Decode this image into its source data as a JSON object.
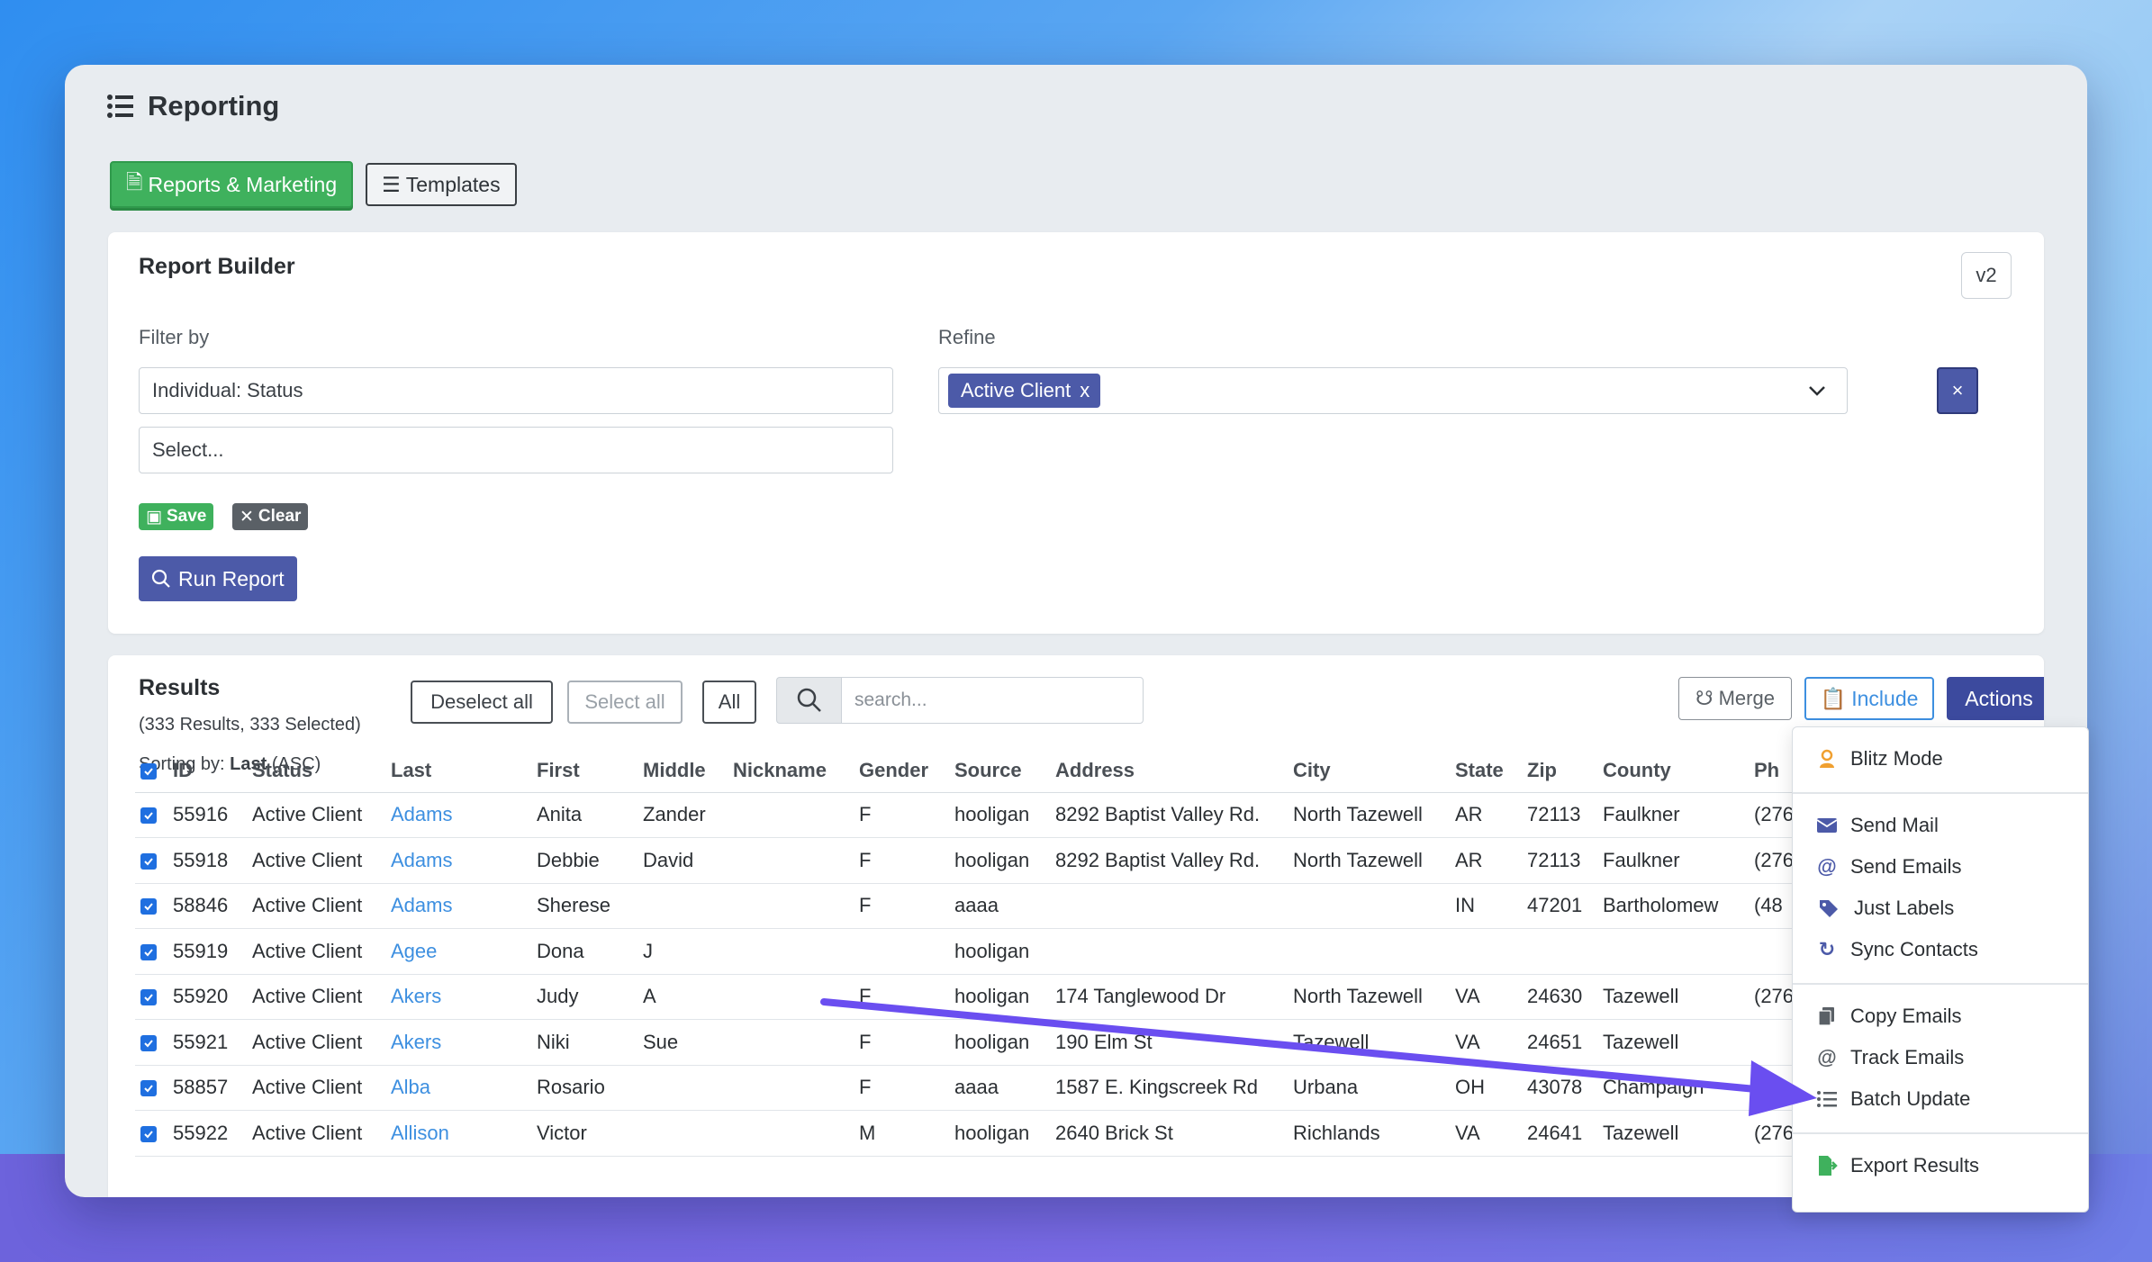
{
  "page": {
    "title": "Reporting"
  },
  "tabs": [
    {
      "label": "Reports & Marketing"
    },
    {
      "label": "Templates"
    }
  ],
  "builder": {
    "title": "Report Builder",
    "version": "v2",
    "filter_label": "Filter by",
    "filter_value": "Individual: Status",
    "filter_placeholder": "Select...",
    "refine_label": "Refine",
    "refine_chip": "Active Client",
    "refine_chip_remove": "x",
    "clear_refine": "×",
    "save_label": "Save",
    "clear_label": "Clear",
    "run_label": "Run Report"
  },
  "results": {
    "title": "Results",
    "summary": "(333 Results, 333 Selected)",
    "sorting_prefix": "Sorting by:",
    "sorting_field": "Last",
    "sorting_dir": "(ASC)",
    "deselect_all": "Deselect all",
    "select_all": "Select all",
    "all": "All",
    "search_placeholder": "search...",
    "merge": "Merge",
    "include": "Include",
    "actions": "Actions",
    "columns": [
      "ID",
      "Status",
      "Last",
      "First",
      "Middle",
      "Nickname",
      "Gender",
      "Source",
      "Address",
      "City",
      "State",
      "Zip",
      "County",
      "Ph"
    ],
    "rows": [
      {
        "id": "55916",
        "status": "Active Client",
        "last": "Adams",
        "first": "Anita",
        "middle": "Zander",
        "nickname": "",
        "gender": "F",
        "source": "hooligan",
        "address": "8292 Baptist Valley Rd.",
        "city": "North Tazewell",
        "state": "AR",
        "zip": "72113",
        "county": "Faulkner",
        "phone": "(276"
      },
      {
        "id": "55918",
        "status": "Active Client",
        "last": "Adams",
        "first": "Debbie",
        "middle": "David",
        "nickname": "",
        "gender": "F",
        "source": "hooligan",
        "address": "8292 Baptist Valley Rd.",
        "city": "North Tazewell",
        "state": "AR",
        "zip": "72113",
        "county": "Faulkner",
        "phone": "(276"
      },
      {
        "id": "58846",
        "status": "Active Client",
        "last": "Adams",
        "first": "Sherese",
        "middle": "",
        "nickname": "",
        "gender": "F",
        "source": "aaaa",
        "address": "",
        "city": "",
        "state": "IN",
        "zip": "47201",
        "county": "Bartholomew",
        "phone": "(48"
      },
      {
        "id": "55919",
        "status": "Active Client",
        "last": "Agee",
        "first": "Dona",
        "middle": "J",
        "nickname": "",
        "gender": "",
        "source": "hooligan",
        "address": "",
        "city": "",
        "state": "",
        "zip": "",
        "county": "",
        "phone": ""
      },
      {
        "id": "55920",
        "status": "Active Client",
        "last": "Akers",
        "first": "Judy",
        "middle": "A",
        "nickname": "",
        "gender": "F",
        "source": "hooligan",
        "address": "174 Tanglewood Dr",
        "city": "North Tazewell",
        "state": "VA",
        "zip": "24630",
        "county": "Tazewell",
        "phone": "(276"
      },
      {
        "id": "55921",
        "status": "Active Client",
        "last": "Akers",
        "first": "Niki",
        "middle": "Sue",
        "nickname": "",
        "gender": "F",
        "source": "hooligan",
        "address": "190 Elm St",
        "city": "Tazewell",
        "state": "VA",
        "zip": "24651",
        "county": "Tazewell",
        "phone": ""
      },
      {
        "id": "58857",
        "status": "Active Client",
        "last": "Alba",
        "first": "Rosario",
        "middle": "",
        "nickname": "",
        "gender": "F",
        "source": "aaaa",
        "address": "1587 E. Kingscreek Rd",
        "city": "Urbana",
        "state": "OH",
        "zip": "43078",
        "county": "Champaign",
        "phone": "(48"
      },
      {
        "id": "55922",
        "status": "Active Client",
        "last": "Allison",
        "first": "Victor",
        "middle": "",
        "nickname": "",
        "gender": "M",
        "source": "hooligan",
        "address": "2640 Brick St",
        "city": "Richlands",
        "state": "VA",
        "zip": "24641",
        "county": "Tazewell",
        "phone": "(276"
      }
    ]
  },
  "actions_menu": [
    {
      "label": "Blitz Mode",
      "icon": "user-badge-icon"
    },
    {
      "label": "Send Mail",
      "icon": "envelope-icon"
    },
    {
      "label": "Send Emails",
      "icon": "at-icon"
    },
    {
      "label": "Just Labels",
      "icon": "tags-icon"
    },
    {
      "label": "Sync Contacts",
      "icon": "sync-icon"
    },
    {
      "label": "Copy Emails",
      "icon": "copy-icon"
    },
    {
      "label": "Track Emails",
      "icon": "at-icon"
    },
    {
      "label": "Batch Update",
      "icon": "list-icon"
    },
    {
      "label": "Export Results",
      "icon": "file-export-icon"
    }
  ],
  "colors": {
    "accent": "#4c5aa8",
    "success": "#3fb15d",
    "link": "#3d8fe0",
    "arrow": "#6a4ef0"
  }
}
